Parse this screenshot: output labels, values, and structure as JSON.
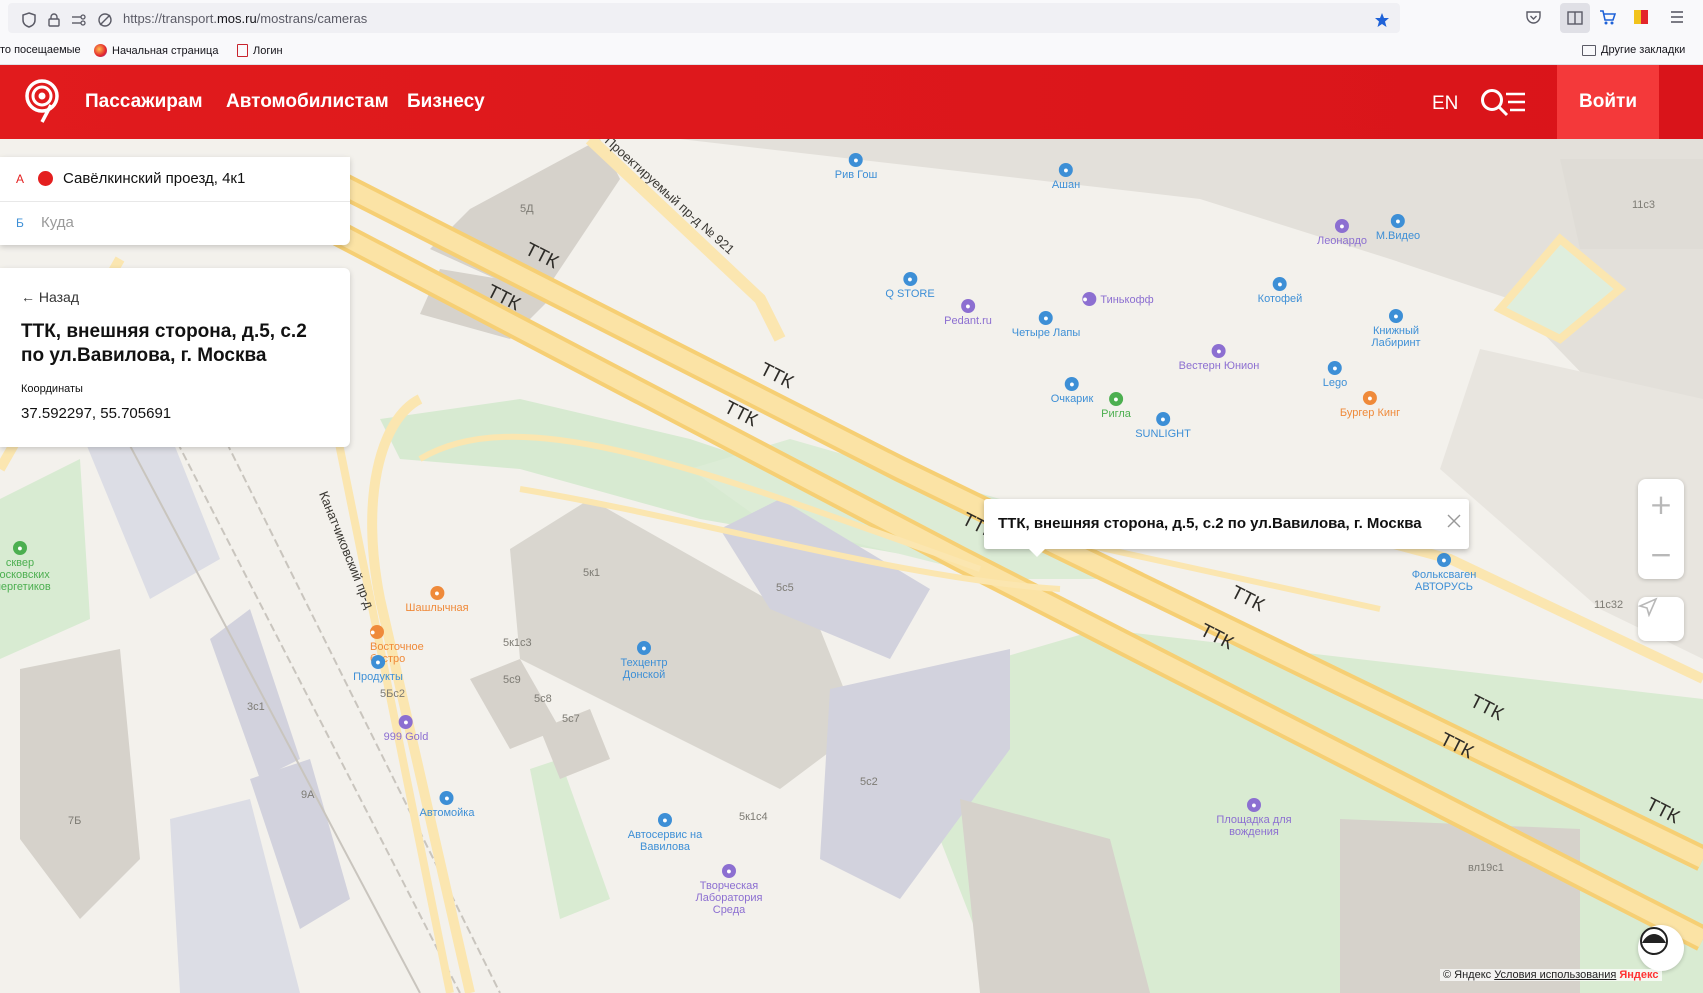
{
  "browser": {
    "url_prefix": "https://transport.",
    "url_domain": "mos.ru",
    "url_path": "/mostrans/cameras",
    "bookmarks": [
      "то посещаемые",
      "Начальная страница",
      "Логин"
    ],
    "other_bookmarks": "Другие закладки"
  },
  "header": {
    "nav": [
      "Пассажирам",
      "Автомобилистам",
      "Бизнесу"
    ],
    "lang": "EN",
    "login": "Войти",
    "brand_color": "#e11b1d"
  },
  "route": {
    "from_letter": "А",
    "from_value": "Савёлкинский проезд, 4к1",
    "to_letter": "Б",
    "to_placeholder": "Куда"
  },
  "card": {
    "back": "← Назад",
    "title_line1": "ТТК, внешняя сторона, д.5, с.2",
    "title_line2": "по ул.Вавилова, г. Москва",
    "coords_label": "Координаты",
    "coords_value": "37.592297, 55.705691"
  },
  "popup": {
    "text": "ТТК, внешняя сторона, д.5, с.2 по ул.Вавилова, г. Москва"
  },
  "map": {
    "road_labels": [
      "ТТК",
      "ТТК",
      "ТТК",
      "ТТК",
      "ТТК",
      "ТТК",
      "ТТК",
      "ТТК",
      "ТТК",
      "ТТК"
    ],
    "streets": [
      "Проектируемый пр-д № 921",
      "Канатчиковский пр-д"
    ],
    "buildings": [
      "5Д",
      "11с3",
      "11с32",
      "5к1",
      "5с5",
      "5к1с3",
      "5с9",
      "5с8",
      "5с7",
      "5Бс2",
      "3с1",
      "9А",
      "7Б",
      "5с2",
      "5к1с4",
      "вл19с1"
    ],
    "pois": [
      {
        "name": "Рив Гош",
        "color": "#3d8fd6",
        "icon": "bag-icon"
      },
      {
        "name": "Ашан",
        "color": "#3d8fd6",
        "icon": "cart-icon"
      },
      {
        "name": "Леонардо",
        "color": "#8c6fd1",
        "icon": "dot-icon"
      },
      {
        "name": "М.Видео",
        "color": "#3d8fd6",
        "icon": "bag-icon"
      },
      {
        "name": "Q STORE",
        "color": "#3d8fd6",
        "icon": "bag-icon"
      },
      {
        "name": "Pedant.ru",
        "color": "#8c6fd1",
        "icon": "phone-icon"
      },
      {
        "name": "Тинькофф",
        "color": "#8c6fd1",
        "icon": "bank-icon"
      },
      {
        "name": "Котофей",
        "color": "#3d8fd6",
        "icon": "shoe-icon"
      },
      {
        "name": "Четыре Лапы",
        "color": "#3d8fd6",
        "icon": "paw-icon"
      },
      {
        "name": "Книжный Лабиринт",
        "color": "#3d8fd6",
        "icon": "book-icon"
      },
      {
        "name": "Вестерн Юнион",
        "color": "#8c6fd1",
        "icon": "money-icon"
      },
      {
        "name": "Lego",
        "color": "#3d8fd6",
        "icon": "toy-icon"
      },
      {
        "name": "Очкарик",
        "color": "#3d8fd6",
        "icon": "glasses-icon"
      },
      {
        "name": "Ригла",
        "color": "#4caf50",
        "icon": "pharmacy-icon"
      },
      {
        "name": "Бургер Кинг",
        "color": "#ef8a3a",
        "icon": "food-icon"
      },
      {
        "name": "SUNLIGHT",
        "color": "#3d8fd6",
        "icon": "jewel-icon"
      },
      {
        "name": "Фольксваген АВТОРУСЬ",
        "color": "#3d8fd6",
        "icon": "car-icon"
      },
      {
        "name": "сквер Московских энергетиков",
        "color": "#4caf50",
        "icon": "tree-icon"
      },
      {
        "name": "Шашлычная",
        "color": "#ef8a3a",
        "icon": "food-icon"
      },
      {
        "name": "Восточное бистро",
        "color": "#ef8a3a",
        "icon": "food-icon"
      },
      {
        "name": "Продукты",
        "color": "#3d8fd6",
        "icon": "cart-icon"
      },
      {
        "name": "999 Gold",
        "color": "#8c6fd1",
        "icon": "jewel-icon"
      },
      {
        "name": "Автомойка",
        "color": "#3d8fd6",
        "icon": "car-icon"
      },
      {
        "name": "Техцентр Донской",
        "color": "#3d8fd6",
        "icon": "car-icon"
      },
      {
        "name": "Автосервис на Вавилова",
        "color": "#3d8fd6",
        "icon": "car-icon"
      },
      {
        "name": "Творческая Лаборатория Среда",
        "color": "#8c6fd1",
        "icon": "dot-icon"
      },
      {
        "name": "Площадка для вождения",
        "color": "#8c6fd1",
        "icon": "dot-icon"
      }
    ]
  },
  "attribution": {
    "text": "© Яндекс",
    "link": "Условия использования",
    "brand": "Яндекс"
  }
}
